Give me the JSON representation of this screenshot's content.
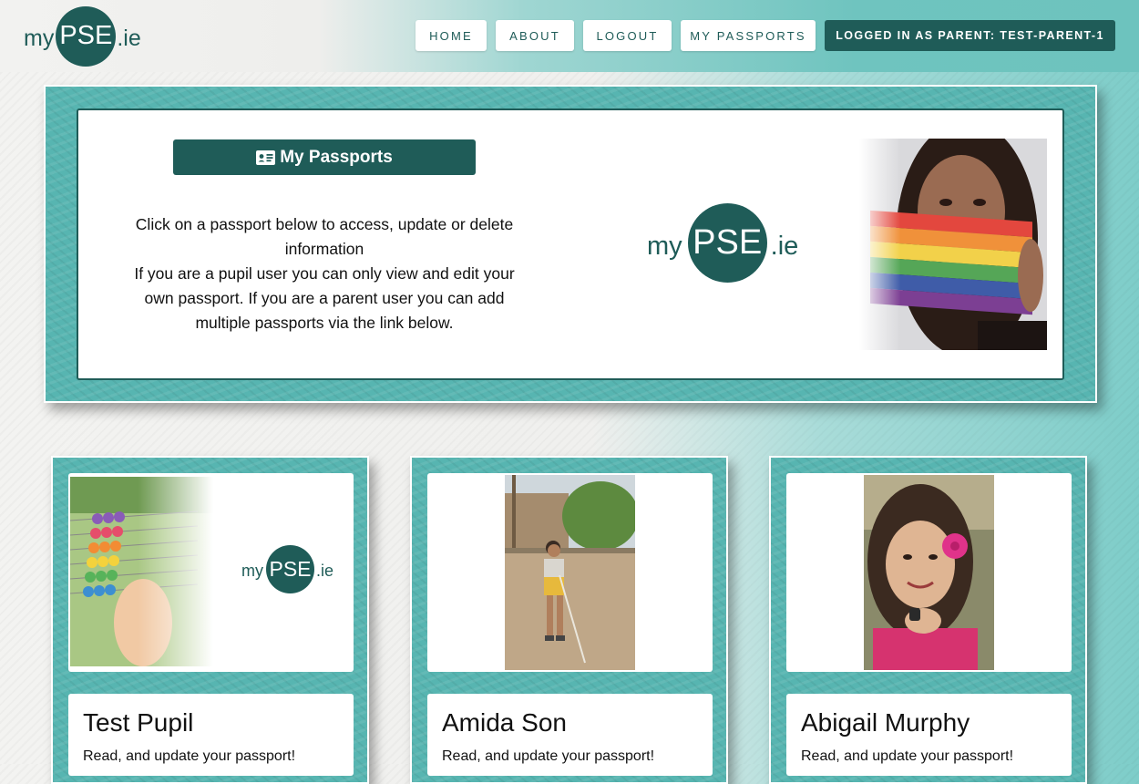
{
  "brand": {
    "prefix": "my",
    "core": "PSE",
    "suffix": ".ie",
    "color": "#1f5c58"
  },
  "nav": {
    "home": "HOME",
    "about": "ABOUT",
    "logout": "LOGOUT",
    "my_passports": "MY PASSPORTS",
    "user_status": "LOGGED IN AS PARENT: TEST-PARENT-1"
  },
  "hero": {
    "button_label": "My Passports",
    "button_icon": "id-card-icon",
    "line1": "Click on a passport below to access, update or delete information",
    "line2": "If you are a pupil user you can only view and edit your own passport. If you are a parent user you can add multiple passports via the link below."
  },
  "cards": [
    {
      "name": "Test Pupil",
      "text": "Read, and update your passport!"
    },
    {
      "name": "Amida Son",
      "text": "Read, and update your passport!"
    },
    {
      "name": "Abigail Murphy",
      "text": "Read, and update your passport!"
    }
  ],
  "colors": {
    "accent": "#1f5c58",
    "teal": "#57b5b1"
  }
}
